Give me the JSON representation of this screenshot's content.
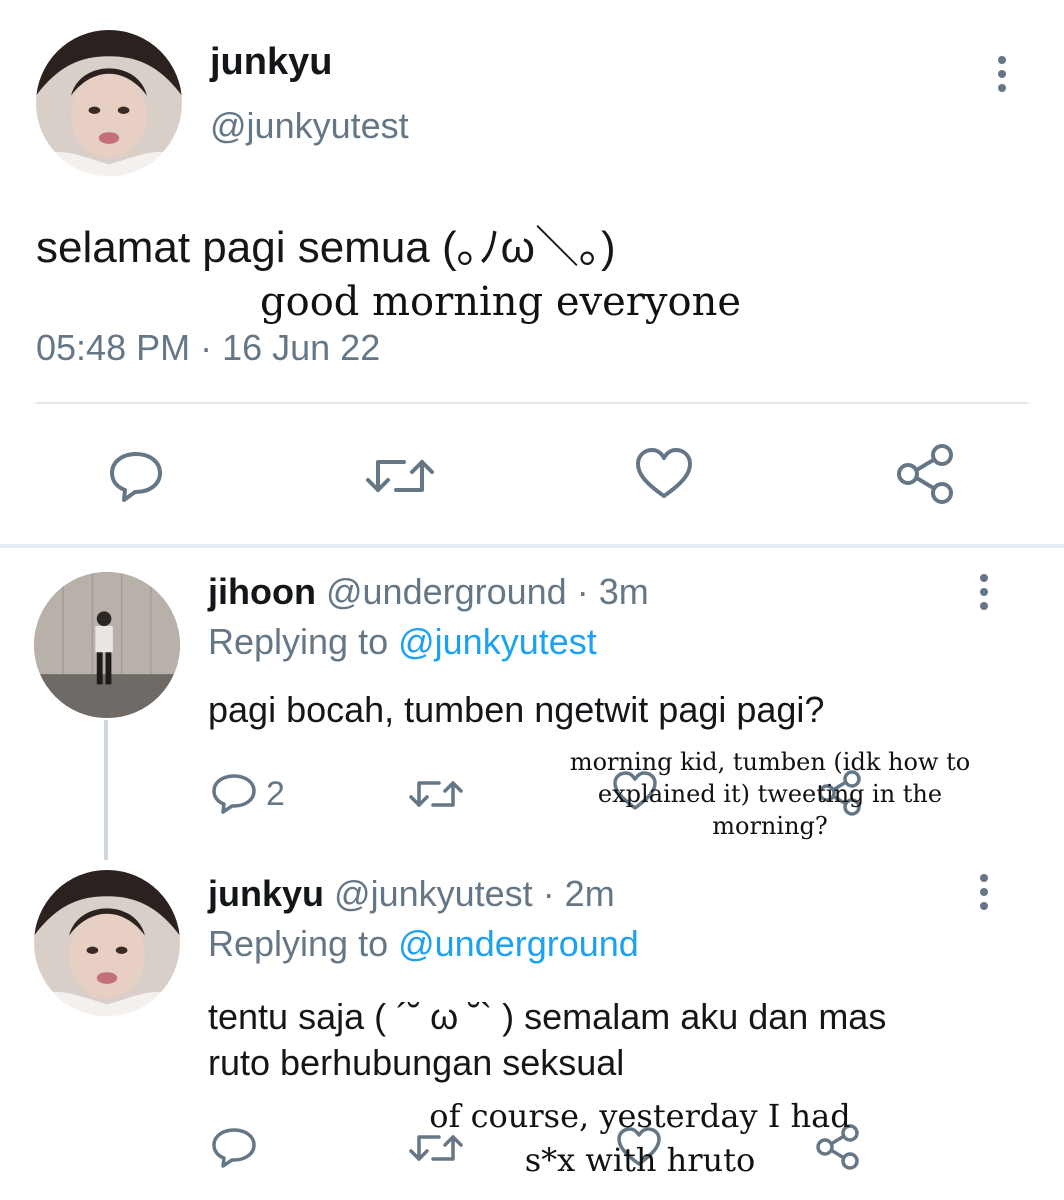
{
  "main_tweet": {
    "author_name": "junkyu",
    "author_handle": "@junkyutest",
    "text": "selamat pagi semua (｡ﾉω＼｡)",
    "translation": "good morning everyone",
    "timestamp": "05:48 PM · 16 Jun 22",
    "actions": {
      "reply_icon": "reply-icon",
      "retweet_icon": "retweet-icon",
      "like_icon": "heart-icon",
      "share_icon": "share-icon"
    }
  },
  "replies": [
    {
      "author_name": "jihoon",
      "author_handle": "@underground",
      "time_ago": "· 3m",
      "replying_prefix": "Replying to ",
      "replying_to": "@junkyutest",
      "text": "pagi bocah, tumben ngetwit pagi pagi?",
      "reply_count": "2",
      "translation_lines": [
        "morning kid, tumben (idk how to",
        "explained it) tweeting in the",
        "morning?"
      ]
    },
    {
      "author_name": "junkyu",
      "author_handle": "@junkyutest",
      "time_ago": "· 2m",
      "replying_prefix": "Replying to ",
      "replying_to": "@underground",
      "text_lines": [
        "tentu saja ( ´˘ ω ˘` ) semalam aku dan mas",
        "ruto berhubungan seksual"
      ],
      "translation_lines": [
        "of course, yesterday I had",
        "s*x with hruto"
      ]
    }
  ],
  "colors": {
    "text": "#14171a",
    "secondary": "#657786",
    "link": "#1da1f2",
    "divider": "#e1e8ed"
  }
}
